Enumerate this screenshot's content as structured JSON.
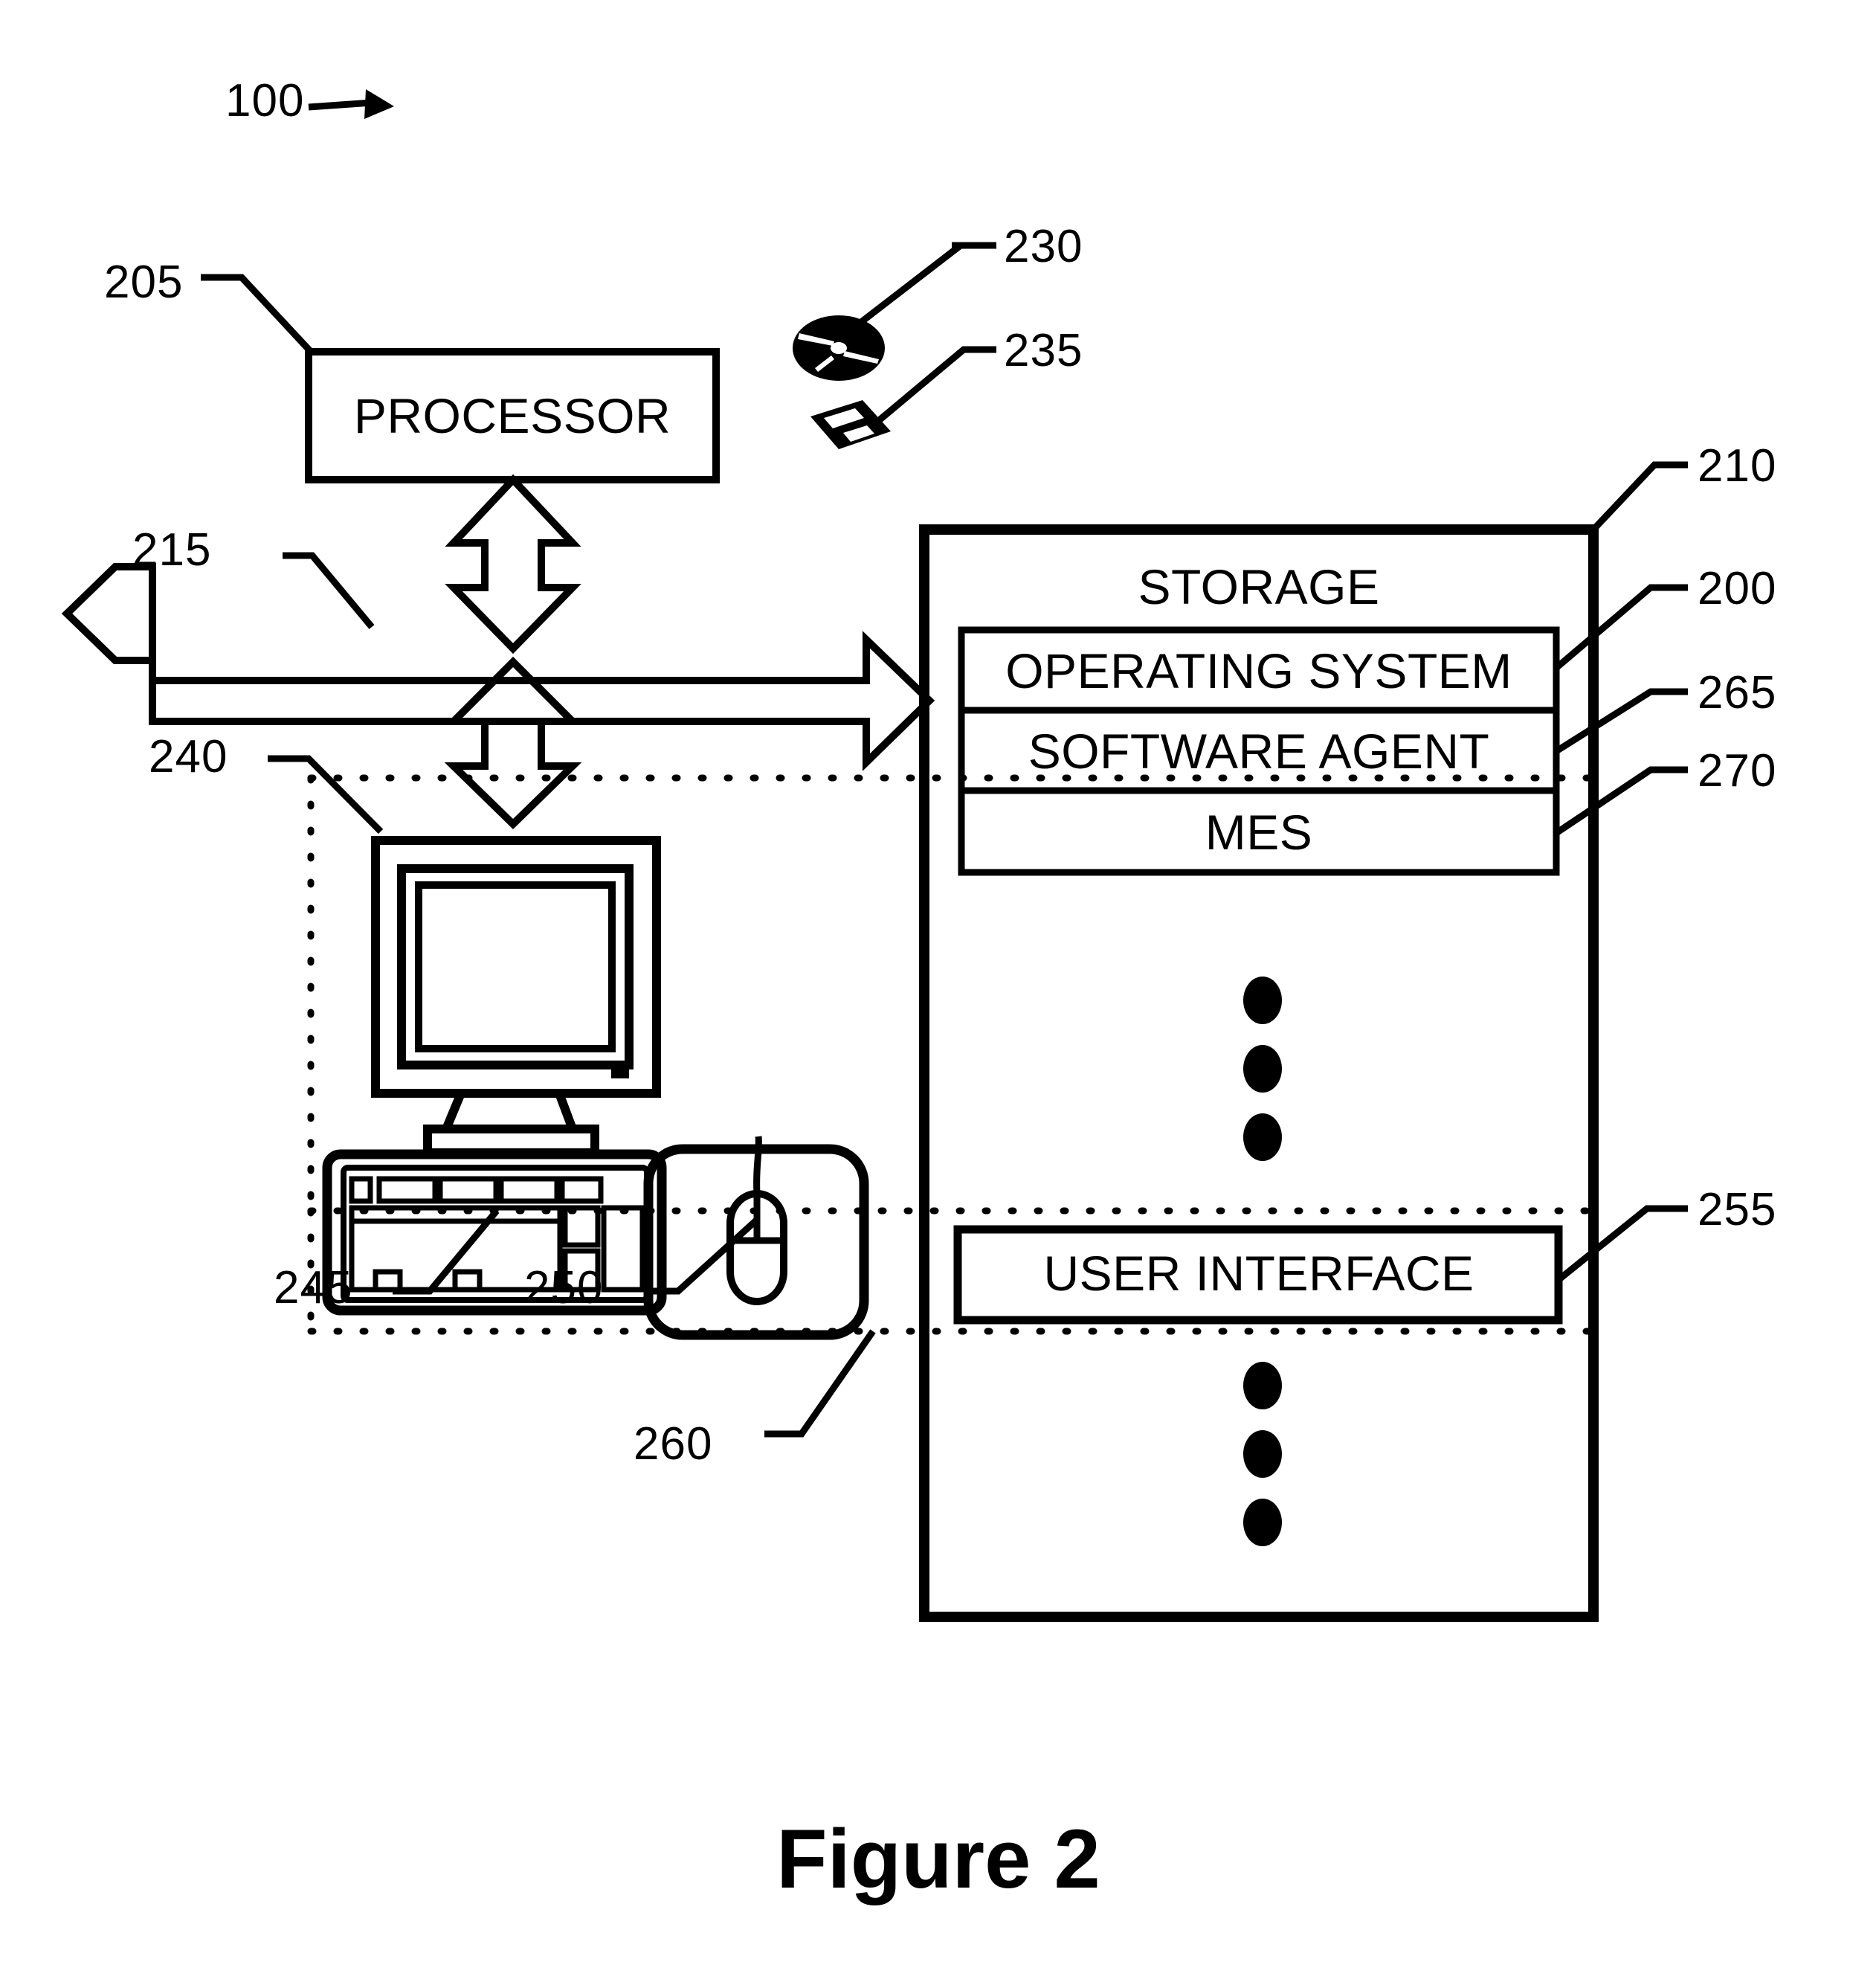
{
  "figure": {
    "caption": "Figure 2",
    "system_ref": "100"
  },
  "components": {
    "processor": {
      "label": "PROCESSOR",
      "ref": "205"
    },
    "bus": {
      "ref": "215"
    },
    "optical_disc": {
      "ref": "230",
      "icon": "compact-disc-icon"
    },
    "floppy_disk": {
      "ref": "235",
      "icon": "floppy-disk-icon"
    },
    "storage": {
      "label": "STORAGE",
      "ref": "210",
      "items": [
        {
          "label": "OPERATING SYSTEM",
          "ref": "200"
        },
        {
          "label": "SOFTWARE AGENT",
          "ref": "265"
        },
        {
          "label": "MES",
          "ref": "270"
        }
      ],
      "user_interface": {
        "label": "USER INTERFACE",
        "ref": "255"
      },
      "ellipsis_upper": "vertical-ellipsis",
      "ellipsis_lower": "vertical-ellipsis"
    },
    "monitor": {
      "ref": "240",
      "icon": "crt-monitor-icon"
    },
    "keyboard": {
      "ref": "245",
      "icon": "keyboard-icon"
    },
    "mouse": {
      "ref": "250",
      "icon": "mouse-icon"
    },
    "dotted_region": {
      "ref": "260"
    }
  },
  "colors": {
    "ink": "#000000",
    "paper": "#ffffff"
  }
}
